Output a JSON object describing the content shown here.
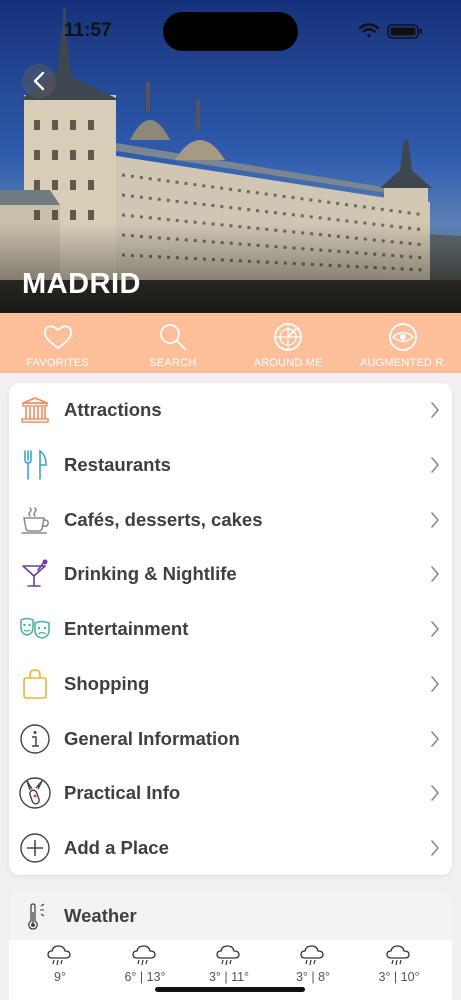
{
  "status_bar": {
    "time": "11:57"
  },
  "header": {
    "city": "MADRID"
  },
  "toolbar": [
    {
      "label": "FAVORITES",
      "icon": "heart-icon"
    },
    {
      "label": "SEARCH",
      "icon": "search-icon"
    },
    {
      "label": "AROUND ME",
      "icon": "radar-icon"
    },
    {
      "label": "AUGMENTED R.",
      "icon": "eye-icon"
    }
  ],
  "menu": [
    {
      "label": "Attractions",
      "icon": "monument-icon",
      "color": "#f08a5d"
    },
    {
      "label": "Restaurants",
      "icon": "cutlery-icon",
      "color": "#3aa6c9"
    },
    {
      "label": "Cafés, desserts, cakes",
      "icon": "coffee-cup-icon",
      "color": "#8a8a8a"
    },
    {
      "label": "Drinking & Nightlife",
      "icon": "cocktail-icon",
      "color": "#6b3f9a"
    },
    {
      "label": "Entertainment",
      "icon": "theater-masks-icon",
      "color": "#45b0a0"
    },
    {
      "label": "Shopping",
      "icon": "shopping-bag-icon",
      "color": "#f2b233"
    },
    {
      "label": "General Information",
      "icon": "info-icon",
      "color": "#444"
    },
    {
      "label": "Practical Info",
      "icon": "swiss-knife-icon",
      "color": "#444"
    },
    {
      "label": "Add a Place",
      "icon": "plus-circle-icon",
      "color": "#444"
    }
  ],
  "weather": {
    "title": "Weather",
    "days": [
      {
        "temp": "9°"
      },
      {
        "temp": "6° | 13°"
      },
      {
        "temp": "3° | 11°"
      },
      {
        "temp": "3° | 8°"
      },
      {
        "temp": "3° | 10°"
      }
    ]
  },
  "colors": {
    "toolbar": "#fdbf99",
    "text": "#3e3e44",
    "background": "#f1eff0"
  }
}
